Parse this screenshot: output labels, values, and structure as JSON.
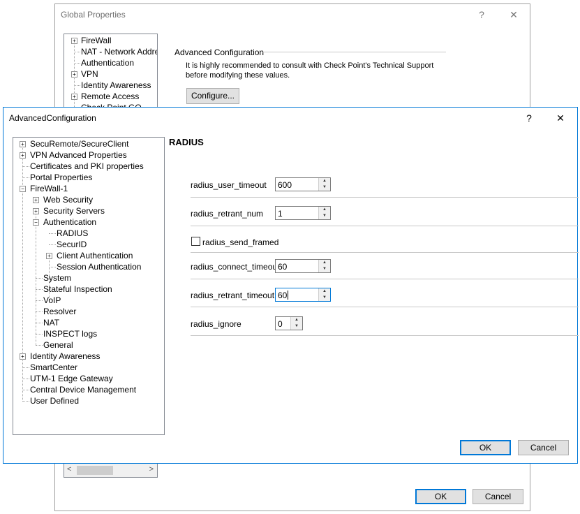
{
  "global": {
    "title": "Global Properties",
    "help": "?",
    "close": "✕",
    "tree": [
      {
        "label": "FireWall",
        "expander": "+"
      },
      {
        "label": "NAT - Network Addres",
        "expander": ""
      },
      {
        "label": "Authentication",
        "expander": ""
      },
      {
        "label": "VPN",
        "expander": "+"
      },
      {
        "label": "Identity Awareness",
        "expander": ""
      },
      {
        "label": "Remote Access",
        "expander": "+"
      },
      {
        "label": "Check Point GO",
        "expander": ""
      }
    ],
    "adv_header": "Advanced Configuration",
    "adv_text_1": "It is highly recommended to consult with Check Point's Technical Support",
    "adv_text_2": "before modifying these values.",
    "configure_label": "Configure...",
    "ok_label": "OK",
    "cancel_label": "Cancel",
    "scroll_left": "<",
    "scroll_right": ">"
  },
  "adv": {
    "title": "AdvancedConfiguration",
    "help": "?",
    "close": "✕",
    "section_title": "RADIUS",
    "tree": [
      {
        "label": "SecuRemote/SecureClient",
        "level": 0,
        "expander": "+"
      },
      {
        "label": "VPN Advanced Properties",
        "level": 0,
        "expander": "+"
      },
      {
        "label": "Certificates and PKI properties",
        "level": 0,
        "expander": ""
      },
      {
        "label": "Portal Properties",
        "level": 0,
        "expander": ""
      },
      {
        "label": "FireWall-1",
        "level": 0,
        "expander": "−"
      },
      {
        "label": "Web Security",
        "level": 1,
        "expander": "+"
      },
      {
        "label": "Security Servers",
        "level": 1,
        "expander": "+"
      },
      {
        "label": "Authentication",
        "level": 1,
        "expander": "−"
      },
      {
        "label": "RADIUS",
        "level": 2,
        "expander": ""
      },
      {
        "label": "SecurID",
        "level": 2,
        "expander": ""
      },
      {
        "label": "Client Authentication",
        "level": 2,
        "expander": "+"
      },
      {
        "label": "Session Authentication",
        "level": 2,
        "expander": ""
      },
      {
        "label": "System",
        "level": 1,
        "expander": ""
      },
      {
        "label": "Stateful Inspection",
        "level": 1,
        "expander": ""
      },
      {
        "label": "VoIP",
        "level": 1,
        "expander": ""
      },
      {
        "label": "Resolver",
        "level": 1,
        "expander": ""
      },
      {
        "label": "NAT",
        "level": 1,
        "expander": ""
      },
      {
        "label": "INSPECT logs",
        "level": 1,
        "expander": ""
      },
      {
        "label": "General",
        "level": 1,
        "expander": ""
      },
      {
        "label": "Identity Awareness",
        "level": 0,
        "expander": "+"
      },
      {
        "label": "SmartCenter",
        "level": 0,
        "expander": ""
      },
      {
        "label": "UTM-1 Edge Gateway",
        "level": 0,
        "expander": ""
      },
      {
        "label": "Central Device Management",
        "level": 0,
        "expander": ""
      },
      {
        "label": "User Defined",
        "level": 0,
        "expander": ""
      }
    ],
    "fields": {
      "radius_user_timeout": {
        "label": "radius_user_timeout",
        "value": "600"
      },
      "radius_retrant_num": {
        "label": "radius_retrant_num",
        "value": "1"
      },
      "radius_send_framed": {
        "label": "radius_send_framed"
      },
      "radius_connect_timeout": {
        "label": "radius_connect_timeout",
        "value": "60"
      },
      "radius_retrant_timeout": {
        "label": "radius_retrant_timeout",
        "value": "60"
      },
      "radius_ignore": {
        "label": "radius_ignore",
        "value": "0"
      }
    },
    "spin_up": "▲",
    "spin_down": "▼",
    "ok_label": "OK",
    "cancel_label": "Cancel"
  },
  "colors": {
    "accent": "#0078d7",
    "frame": "#0078d7",
    "selection": "#0078d7"
  }
}
